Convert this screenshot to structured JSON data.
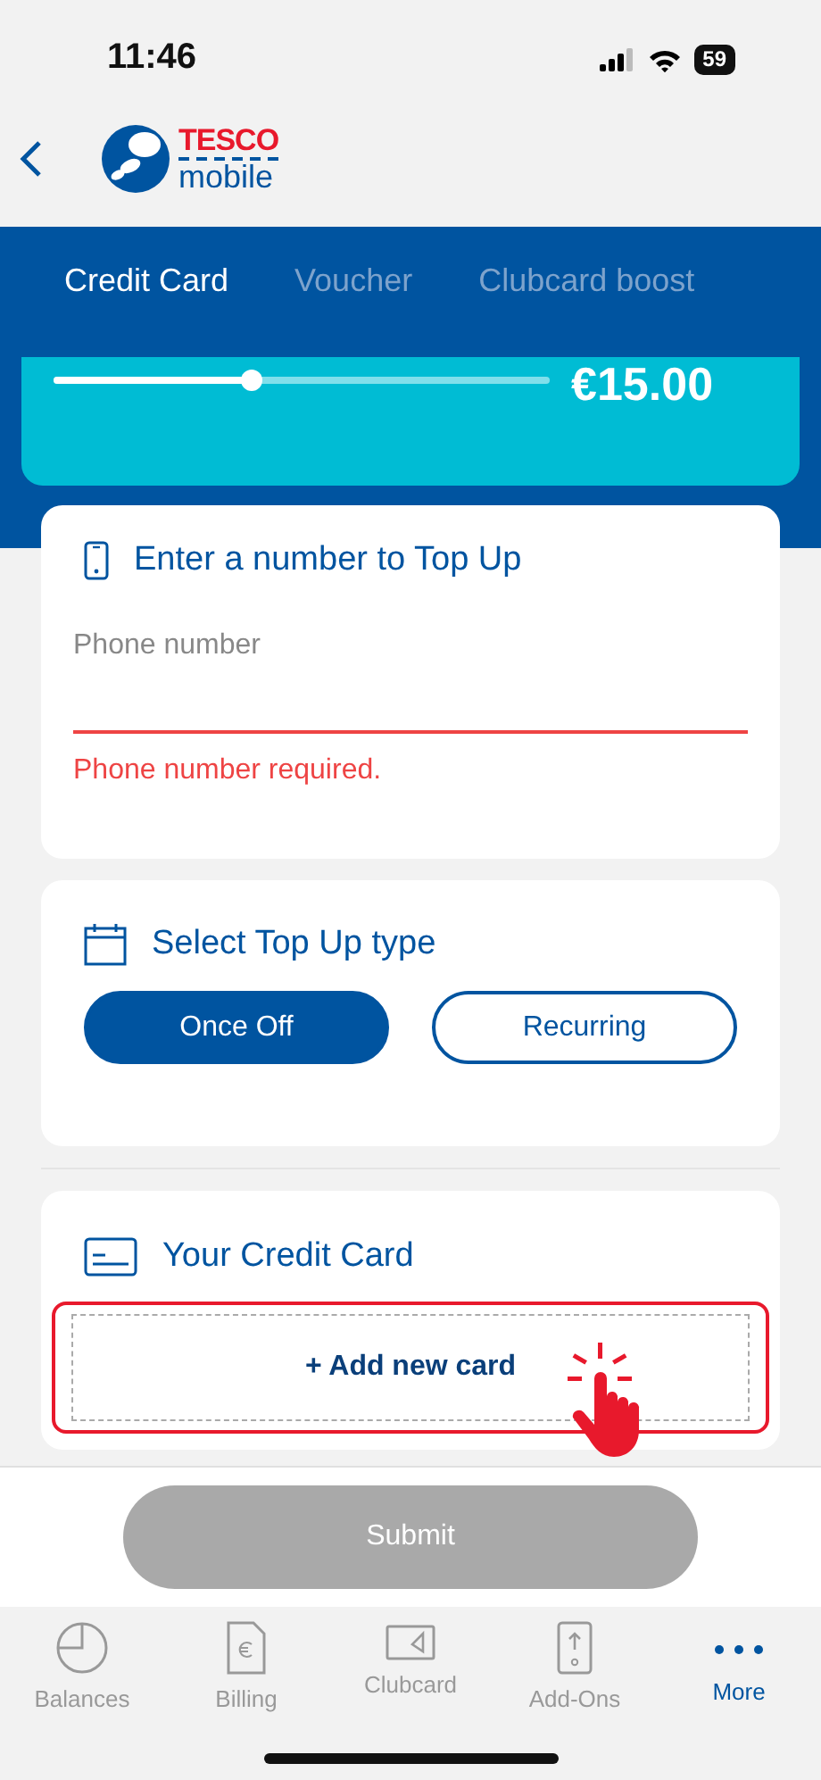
{
  "status_bar": {
    "time": "11:46",
    "battery": "59"
  },
  "header": {
    "brand_top": "TESCO",
    "brand_bottom": "mobile"
  },
  "tabs": [
    {
      "label": "Credit Card",
      "selected": true
    },
    {
      "label": "Voucher",
      "selected": false
    },
    {
      "label": "Clubcard boost",
      "selected": false
    }
  ],
  "amount": {
    "level": 0.4,
    "value": "€15.00"
  },
  "number_card": {
    "title": "Enter a number to Top Up",
    "field": {
      "placeholder": "Phone number",
      "error": "Phone number required."
    }
  },
  "type_card": {
    "title": "Select Top Up type",
    "options": [
      {
        "label": "Once Off",
        "selected": true
      },
      {
        "label": "Recurring",
        "selected": false
      }
    ]
  },
  "credit_card": {
    "title": "Your Credit Card",
    "add_button": "+ Add new card"
  },
  "submit": {
    "label": "Submit",
    "disabled": true
  },
  "nav": [
    {
      "label": "Balances",
      "selected": false
    },
    {
      "label": "Billing",
      "selected": false
    },
    {
      "label": "Clubcard",
      "selected": false
    },
    {
      "label": "Add-Ons",
      "selected": false
    },
    {
      "label": "More",
      "selected": true
    }
  ]
}
